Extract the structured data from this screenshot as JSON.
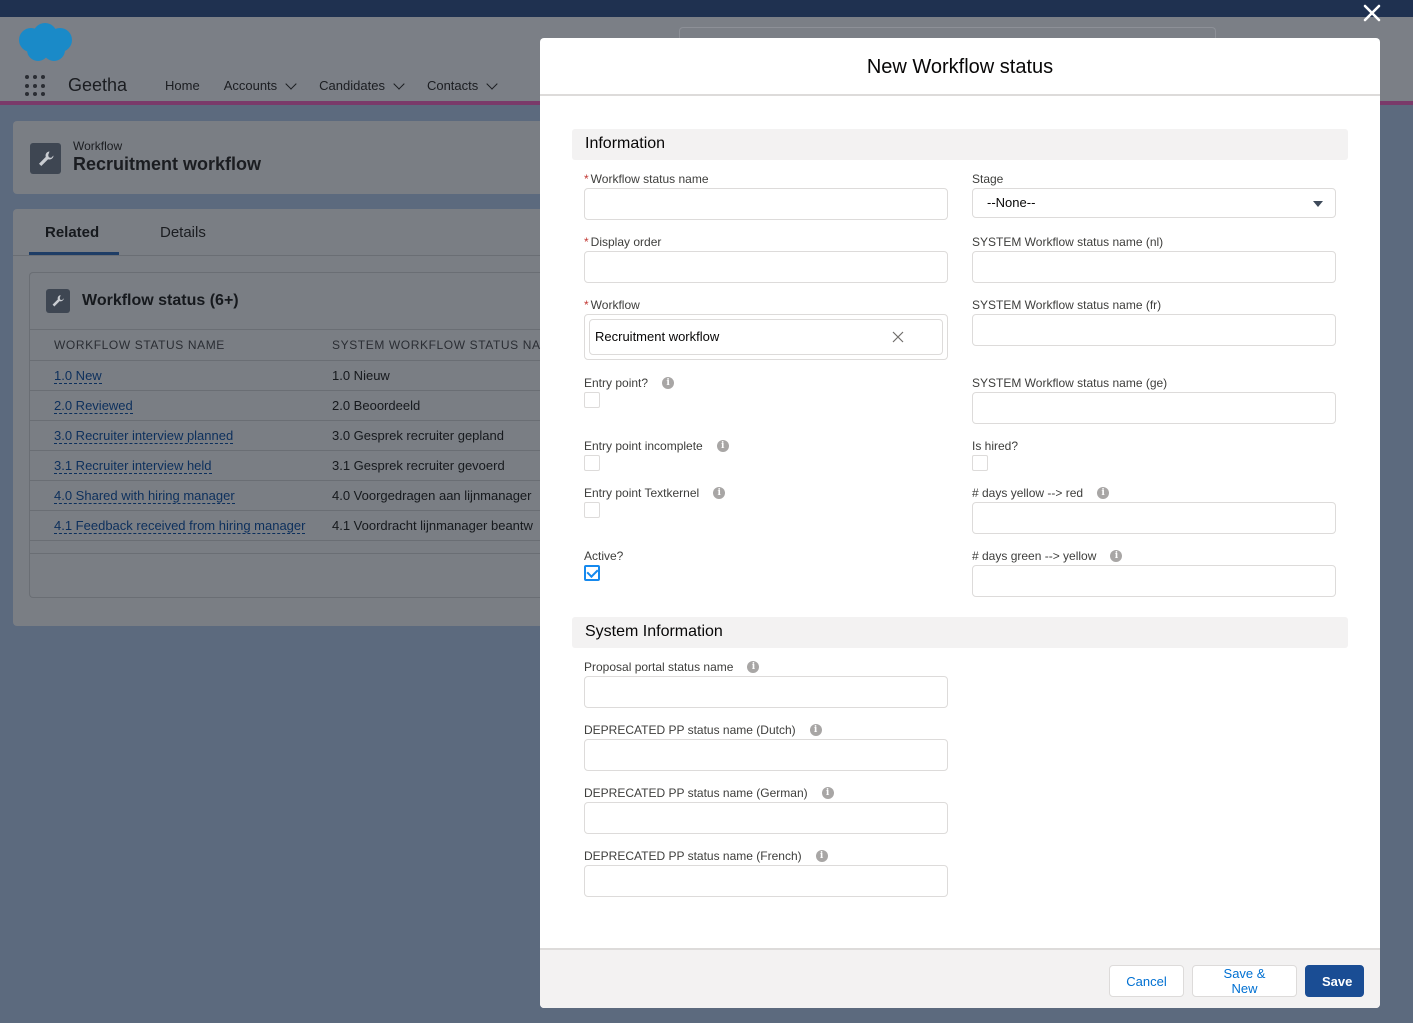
{
  "app": {
    "name": "Geetha",
    "nav": [
      {
        "label": "Home"
      },
      {
        "label": "Accounts"
      },
      {
        "label": "Candidates"
      },
      {
        "label": "Contacts"
      }
    ]
  },
  "record": {
    "type": "Workflow",
    "title": "Recruitment workflow"
  },
  "tabs": {
    "related": "Related",
    "details": "Details"
  },
  "related_list": {
    "title": "Workflow status (6+)",
    "columns": [
      "WORKFLOW STATUS NAME",
      "SYSTEM WORKFLOW STATUS NA"
    ],
    "rows": [
      {
        "name": "1.0 New",
        "system": "1.0 Nieuw"
      },
      {
        "name": "2.0 Reviewed",
        "system": "2.0 Beoordeeld"
      },
      {
        "name": "3.0 Recruiter interview planned",
        "system": "3.0 Gesprek recruiter gepland"
      },
      {
        "name": "3.1 Recruiter interview held",
        "system": "3.1 Gesprek recruiter gevoerd"
      },
      {
        "name": "4.0 Shared with hiring manager",
        "system": "4.0 Voorgedragen aan lijnmanager"
      },
      {
        "name": "4.1 Feedback received from hiring manager",
        "system": "4.1 Voordracht lijnmanager beantw"
      }
    ]
  },
  "modal": {
    "title": "New Workflow status",
    "sections": {
      "information": "Information",
      "system_information": "System Information"
    },
    "required_mark": "*",
    "fields": {
      "workflow_status_name": {
        "label": "Workflow status name",
        "value": ""
      },
      "display_order": {
        "label": "Display order",
        "value": ""
      },
      "workflow": {
        "label": "Workflow",
        "value": "Recruitment workflow"
      },
      "entry_point": {
        "label": "Entry point?",
        "checked": false
      },
      "entry_point_incomplete": {
        "label": "Entry point incomplete",
        "checked": false
      },
      "entry_point_textkernel": {
        "label": "Entry point Textkernel",
        "checked": false
      },
      "active": {
        "label": "Active?",
        "checked": true
      },
      "stage": {
        "label": "Stage",
        "value": "--None--"
      },
      "sys_nl": {
        "label": "SYSTEM Workflow status name (nl)",
        "value": ""
      },
      "sys_fr": {
        "label": "SYSTEM Workflow status name (fr)",
        "value": ""
      },
      "sys_ge": {
        "label": "SYSTEM Workflow status name (ge)",
        "value": ""
      },
      "is_hired": {
        "label": "Is hired?",
        "checked": false
      },
      "days_yellow_red": {
        "label": "# days yellow --> red",
        "value": ""
      },
      "days_green_yellow": {
        "label": "# days green --> yellow",
        "value": ""
      },
      "proposal_portal": {
        "label": "Proposal portal status name",
        "value": ""
      },
      "pp_dutch": {
        "label": "DEPRECATED PP status name (Dutch)",
        "value": ""
      },
      "pp_german": {
        "label": "DEPRECATED PP status name (German)",
        "value": ""
      },
      "pp_french": {
        "label": "DEPRECATED PP status name (French)",
        "value": ""
      }
    },
    "info_glyph": "i",
    "buttons": {
      "cancel": "Cancel",
      "save_new": "Save & New",
      "save": "Save"
    }
  },
  "icons": {
    "close": "close-icon",
    "wrench": "wrench-icon",
    "clear": "clear-icon",
    "info": "info-icon",
    "caret": "caret-down-icon",
    "app_launcher": "app-launcher-icon",
    "logo": "salesforce-cloud-icon"
  },
  "colors": {
    "brand": "#1a4d94",
    "link": "#0070d2",
    "checkbox": "#1589ee",
    "required": "#c23934"
  }
}
